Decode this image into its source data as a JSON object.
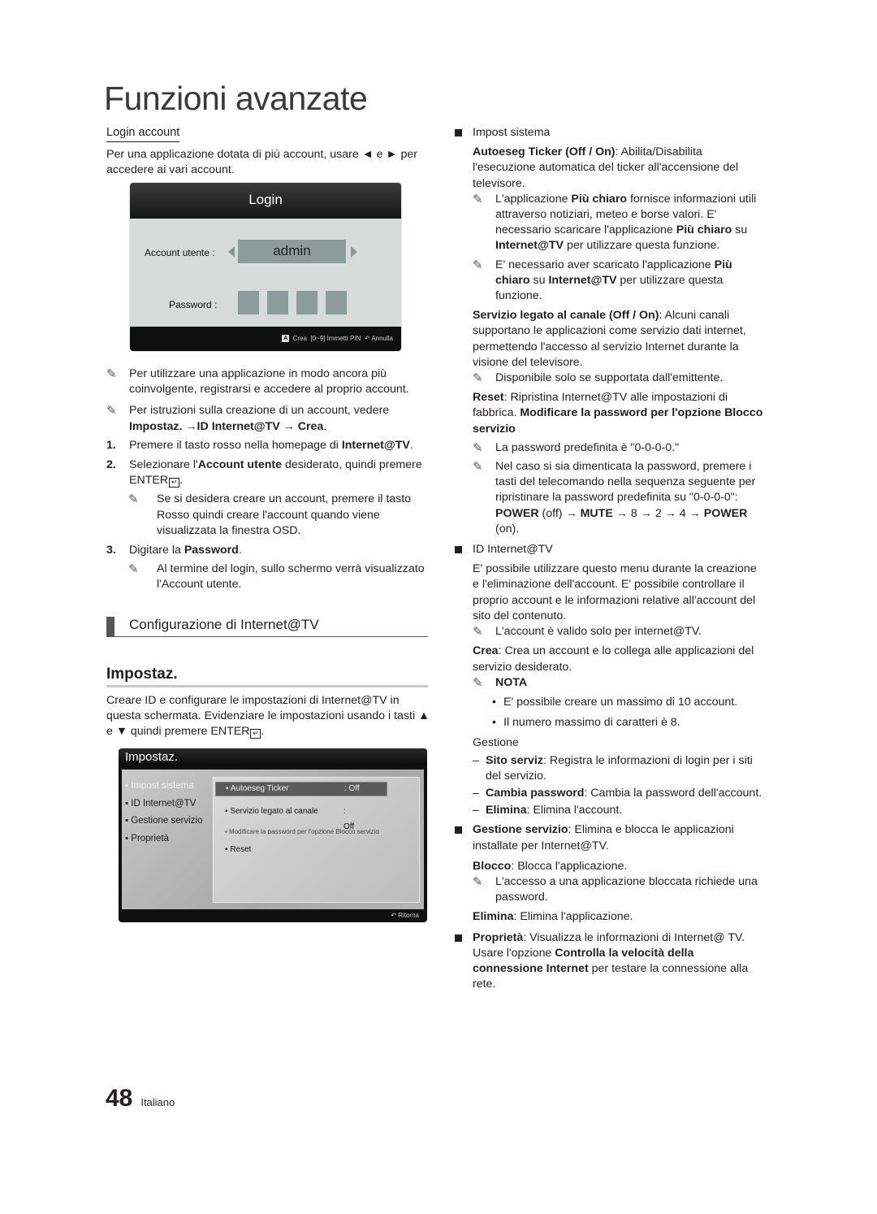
{
  "page": {
    "title": "Funzioni avanzate",
    "number": "48",
    "language": "Italiano"
  },
  "left": {
    "login_account": {
      "heading": "Login account",
      "text": "Per una applicazione dotata di più account, usare ◄ e ► per accedere ai vari account."
    },
    "login_osd": {
      "title": "Login",
      "account_label": "Account utente :",
      "account_value": "admin",
      "password_label": "Password :",
      "footer_key": "A",
      "footer_create": "Crea",
      "footer_pin": "[0~9] Immetti PIN",
      "footer_back_icon": "↶",
      "footer_cancel": "Annulla"
    },
    "notes": [
      "Per utilizzare una applicazione in modo ancora più coinvolgente, registrarsi e accedere al proprio account.",
      "Per istruzioni sulla creazione di un account, vedere"
    ],
    "note2_bold": "Impostaz. →ID Internet@TV → Crea",
    "steps": {
      "s1_num": "1.",
      "s1_text": "Premere il tasto rosso nella homepage di ",
      "s1_bold": "Internet@TV",
      "s2_num": "2.",
      "s2_text_a": "Selezionare l'",
      "s2_bold": "Account utente",
      "s2_text_b": " desiderato, quindi premere ENTER",
      "s2_note": "Se si desidera creare un account, premere il tasto Rosso quindi creare l'account quando viene visualizzata la finestra OSD.",
      "s3_num": "3.",
      "s3_text": "Digitare la ",
      "s3_bold": "Password",
      "s3_note": "Al termine del login, sullo schermo verrà visualizzato l'Account utente."
    },
    "section_heading": "Configurazione di Internet@TV",
    "impostaz_heading": "Impostaz.",
    "intro_a": "Creare ID e configurare le impostazioni di Internet@TV in questa schermata. Evidenziare le impostazioni usando i tasti ▲ e ▼ quindi premere ENTER",
    "impostaz_osd": {
      "title": "Impostaz.",
      "menu": [
        "▪ Impost sistema",
        "▪ ID Internet@TV",
        "▪ Gestione servizio",
        "▪ Proprietà"
      ],
      "options": [
        {
          "label": "▪ Autoeseg Ticker",
          "value": ": Off"
        },
        {
          "label": "▪ Servizio legato al canale",
          "value": ": Off"
        },
        {
          "label": "▪ Modificare la password per l'opzione Blocco servizio",
          "value": ""
        },
        {
          "label": "▪ Reset",
          "value": ""
        }
      ],
      "footer_back_icon": "↶",
      "footer_return": "Ritorna"
    }
  },
  "right": {
    "impost_sistema": "Impost sistema",
    "autoeseg_bold": "Autoeseg Ticker (Off / On)",
    "autoeseg_text": ": Abilita/Disabilita l'esecuzione automatica del ticker all'accensione del televisore.",
    "note_piu_chiaro_1": {
      "a": "L'applicazione ",
      "b1": "Più chiaro",
      "c": " fornisce informazioni utili attraverso notiziari, meteo e borse valori. E' necessario scaricare l'applicazione ",
      "b2": "Più chiaro",
      "d": " su ",
      "b3": "Internet@TV",
      "e": " per utilizzare questa funzione."
    },
    "note_piu_chiaro_2": {
      "a": "E' necessario aver scaricato l'applicazione ",
      "b1": "Più chiaro",
      "c": " su ",
      "b2": "Internet@TV",
      "d": " per utilizzare questa funzione."
    },
    "servizio_bold": "Servizio legato al canale (Off / On)",
    "servizio_text": ": Alcuni canali supportano le applicazioni come servizio dati internet, permettendo l'accesso al servizio Internet durante la visione del televisore.",
    "servizio_note": "Disponibile solo se supportata dall'emittente.",
    "reset_bold": "Reset",
    "reset_text": ": Ripristina Internet@TV alle impostazioni di fabbrica. ",
    "reset_bold2": "Modificare la password per l'opzione Blocco servizio",
    "pwd_note": "La password predefinita è \"0-0-0-0.\"",
    "forgot_note_a": "Nel caso si sia dimenticata la password, premere i tasti del telecomando nella sequenza seguente per ripristinare la password predefinita su \"0-0-0-0\": ",
    "forgot_power": "POWER",
    "forgot_off": " (off) → ",
    "forgot_mute": "MUTE",
    "forgot_seq": " → 8 → 2 → 4 → ",
    "forgot_power2": "POWER",
    "forgot_on": " (on).",
    "id_heading": "ID Internet@TV",
    "id_text": "E' possibile utilizzare questo menu durante la creazione e l'eliminazione dell'account. E' possibile controllare il proprio account e le informazioni relative all'account del sito del contenuto.",
    "id_note": "L'account è valido solo per internet@TV.",
    "crea_bold": "Crea",
    "crea_text": ": Crea un account e lo collega alle applicazioni del servizio desiderato.",
    "nota": "NOTA",
    "nota_items": [
      "E' possibile creare un massimo di 10 account.",
      "Il numero massimo di caratteri è 8."
    ],
    "gestione": "Gestione",
    "gestione_items": [
      {
        "bold": "Sito serviz",
        "text": ": Registra le informazioni di login per i siti del servizio."
      },
      {
        "bold": "Cambia password",
        "text": ": Cambia la password dell'account."
      },
      {
        "bold": "Elimina",
        "text": ": Elimina l'account."
      }
    ],
    "gs_bold": "Gestione servizio",
    "gs_text": ": Elimina e blocca le applicazioni installate per Internet@TV.",
    "blocco_bold": "Blocco",
    "blocco_text": ": Blocca l'applicazione.",
    "blocco_note": "L'accesso a una applicazione bloccata richiede una password.",
    "elimina_bold": "Elimina",
    "elimina_text": ": Elimina l'applicazione.",
    "prop_bold": "Proprietà",
    "prop_text_a": ": Visualizza le informazioni di Internet@ TV. Usare l'opzione ",
    "prop_bold2": "Controlla la velocità della connessione Internet",
    "prop_text_b": " per testare la connessione alla rete."
  }
}
